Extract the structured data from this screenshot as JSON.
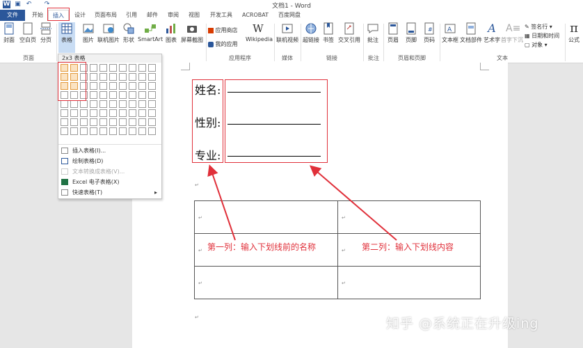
{
  "window": {
    "title": "文档1 - Word"
  },
  "tabs": [
    {
      "label": "文件"
    },
    {
      "label": "开始"
    },
    {
      "label": "插入"
    },
    {
      "label": "设计"
    },
    {
      "label": "页面布局"
    },
    {
      "label": "引用"
    },
    {
      "label": "邮件"
    },
    {
      "label": "审阅"
    },
    {
      "label": "视图"
    },
    {
      "label": "开发工具"
    },
    {
      "label": "ACROBAT"
    },
    {
      "label": "百度网盘"
    }
  ],
  "ribbon": {
    "buttons": {
      "cover": "封面",
      "blank": "空白页",
      "pagebreak": "分页",
      "table": "表格",
      "picture": "图片",
      "online_pic": "联机图片",
      "shapes": "形状",
      "smartart": "SmartArt",
      "chart": "图表",
      "screenshot": "屏幕截图",
      "store": "应用商店",
      "myapps": "我的应用",
      "wikipedia": "Wikipedia",
      "online_video": "联机视频",
      "hyperlink": "超链接",
      "bookmark": "书签",
      "crossref": "交叉引用",
      "comment": "批注",
      "header": "页眉",
      "footer": "页脚",
      "pagenum": "页码",
      "textbox": "文本框",
      "quickparts": "文档部件",
      "wordart": "艺术字",
      "dropcap": "首字下沉",
      "signature": "签名行",
      "datetime": "日期和时间",
      "object": "对象",
      "equation": "公式"
    },
    "groups": {
      "pages": "页面",
      "apps": "应用程序",
      "media": "媒体",
      "links": "链接",
      "comments": "批注",
      "headerfooter": "页眉和页脚",
      "text": "文本"
    }
  },
  "dropdown": {
    "header": "2x3 表格",
    "grid": {
      "cols": 10,
      "rows": 8,
      "selected_cols": 2,
      "selected_rows": 3
    },
    "items": [
      {
        "label": "插入表格(I)...",
        "enabled": true
      },
      {
        "label": "绘制表格(D)",
        "enabled": true
      },
      {
        "label": "文本转换成表格(V)...",
        "enabled": false
      },
      {
        "label": "Excel 电子表格(X)",
        "enabled": true
      },
      {
        "label": "快速表格(T)",
        "enabled": true,
        "submenu": true
      }
    ]
  },
  "document": {
    "labels": [
      "姓名:",
      "性别:",
      "专业:"
    ],
    "paragraph_mark": "↵",
    "annotation_col1": "第一列：输入下划线前的名称",
    "annotation_col2": "第二列：输入下划线内容"
  },
  "watermark": "知乎 @系统正在升级ing",
  "colors": {
    "accent": "#2b579a",
    "highlight": "#e0303a",
    "grid_selected": "#fbe3c2"
  }
}
